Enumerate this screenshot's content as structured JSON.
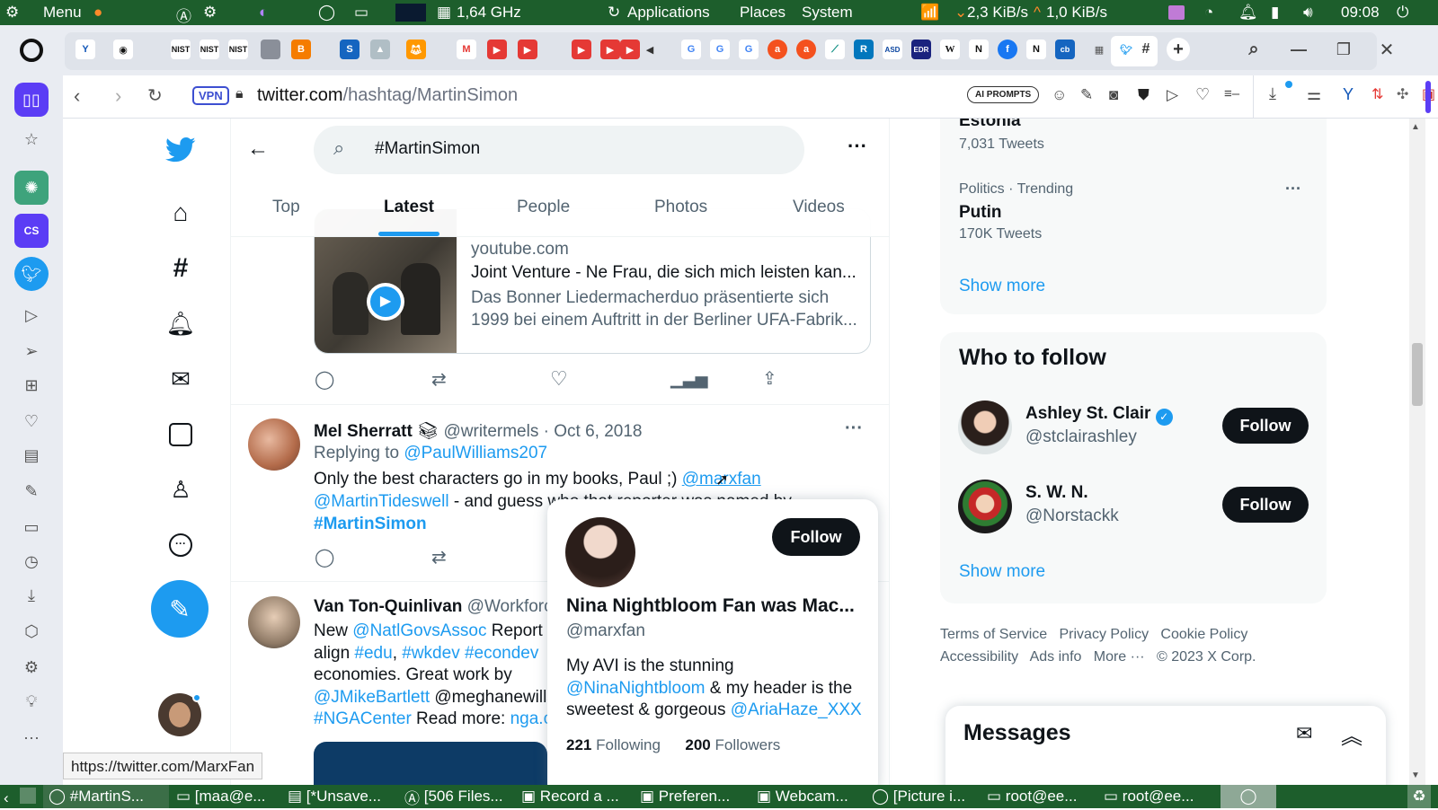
{
  "system_bar": {
    "menu": "Menu",
    "cpu": "1,64 GHz",
    "applications": "Applications",
    "places": "Places",
    "system": "System",
    "net_down": "2,3 KiB/s",
    "net_up": "1,0 KiB/s",
    "clock": "09:08"
  },
  "address_bar": {
    "vpn": "VPN",
    "url_domain": "twitter.com",
    "url_path": "/hashtag/MartinSimon",
    "ai_prompts": "AI PROMPTS"
  },
  "search": {
    "query": "#MartinSimon"
  },
  "tabs": [
    {
      "label": "Top"
    },
    {
      "label": "Latest"
    },
    {
      "label": "People"
    },
    {
      "label": "Photos"
    },
    {
      "label": "Videos"
    }
  ],
  "link_card": {
    "domain": "youtube.com",
    "title": "Joint Venture - Ne Frau, die sich mich leisten kan...",
    "desc": "Das Bonner Liedermacherduo präsentierte sich 1999 bei einem Auftritt in der Berliner UFA-Fabrik..."
  },
  "tweet1": {
    "name": "Mel Sherratt",
    "handle": "@writermels",
    "date": "· Oct 6, 2018",
    "reply_prefix": "Replying to",
    "reply_to": "@PaulWilliams207",
    "text1": "Only the best characters go in my books, Paul ;) ",
    "mention1": "@marxfan",
    "mention2": "@MartinTideswell",
    "text2": " - and guess who that reporter was named by",
    "hashtag": "#MartinSimon"
  },
  "tweet2": {
    "name": "Van Ton-Quinlivan",
    "handle": "@Workforce",
    "t1": "New ",
    "mention1": "@NatlGovsAssoc",
    "t2": " Report p",
    "t3": "align ",
    "tag1": "#edu",
    "tag2": "#wkdev",
    "tag3": "#econdev",
    "t4": "economies. Great work by",
    "mention2": "@JMikeBartlett",
    "t5": " @meghanewills",
    "tag4": "#NGACenter",
    "t6": " Read more: ",
    "link": "nga.o"
  },
  "hover_card": {
    "follow": "Follow",
    "name": "Nina Nightbloom Fan was Mac...",
    "handle": "@marxfan",
    "bio1": "My AVI is the stunning",
    "bio_mention1": "@NinaNightbloom",
    "bio2": " & my header is the sweetest & gorgeous ",
    "bio_mention2": "@AriaHaze_XXX",
    "following_count": "221",
    "following_label": "Following",
    "followers_count": "200",
    "followers_label": "Followers"
  },
  "status_url": "https://twitter.com/MarxFan",
  "trends": {
    "item1_name": "Estonia",
    "item1_count": "7,031 Tweets",
    "item2_meta": "Politics · Trending",
    "item2_name": "Putin",
    "item2_count": "170K Tweets",
    "show_more": "Show more"
  },
  "who_to_follow": {
    "title": "Who to follow",
    "users": [
      {
        "name": "Ashley St. Clair",
        "handle": "@stclairashley",
        "button": "Follow"
      },
      {
        "name": "S. W. N.",
        "handle": "@Norstackk",
        "button": "Follow"
      }
    ],
    "show_more": "Show more"
  },
  "footer": {
    "terms": "Terms of Service",
    "privacy": "Privacy Policy",
    "cookie": "Cookie Policy",
    "accessibility": "Accessibility",
    "ads": "Ads info",
    "more": "More ···",
    "copyright": "© 2023 X Corp."
  },
  "messages": {
    "title": "Messages"
  },
  "taskbar": [
    {
      "label": "#MartinS..."
    },
    {
      "label": "[maa@e..."
    },
    {
      "label": "[*Unsave..."
    },
    {
      "label": "[506 Files..."
    },
    {
      "label": "Record a ..."
    },
    {
      "label": "Preferen..."
    },
    {
      "label": "Webcam..."
    },
    {
      "label": "[Picture i..."
    },
    {
      "label": "root@ee..."
    },
    {
      "label": "root@ee..."
    }
  ],
  "colors": {
    "twitter_blue": "#1d9bf0",
    "dark": "#0f1419",
    "muted": "#536471",
    "system_green": "#1d5e2c"
  }
}
